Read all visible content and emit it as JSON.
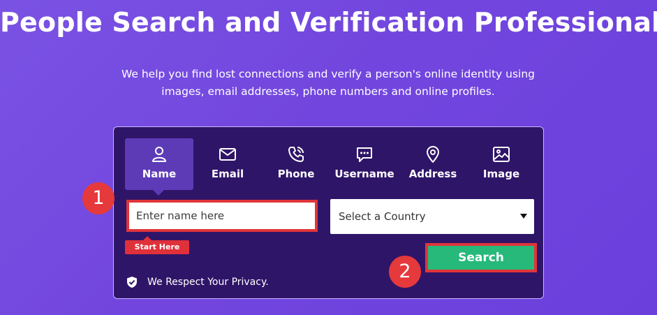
{
  "hero": {
    "title": "People Search and Verification Professionals",
    "subtitle": "We help you find lost connections and verify a person's online identity using images, email addresses, phone numbers and online profiles."
  },
  "tabs": [
    {
      "label": "Name",
      "icon": "person-icon",
      "active": true
    },
    {
      "label": "Email",
      "icon": "envelope-icon",
      "active": false
    },
    {
      "label": "Phone",
      "icon": "phone-icon",
      "active": false
    },
    {
      "label": "Username",
      "icon": "chat-bubble-icon",
      "active": false
    },
    {
      "label": "Address",
      "icon": "location-pin-icon",
      "active": false
    },
    {
      "label": "Image",
      "icon": "image-icon",
      "active": false
    }
  ],
  "form": {
    "name_placeholder": "Enter name here",
    "country_value": "Select a Country",
    "start_here_label": "Start Here",
    "search_label": "Search",
    "privacy_text": "We Respect Your Privacy."
  },
  "annotations": {
    "step1": "1",
    "step2": "2",
    "highlight_color": "#e0353a"
  },
  "colors": {
    "background": "#7246de",
    "card": "#2f1568",
    "active_tab": "#5d3bb7",
    "search_button": "#26b97a"
  }
}
